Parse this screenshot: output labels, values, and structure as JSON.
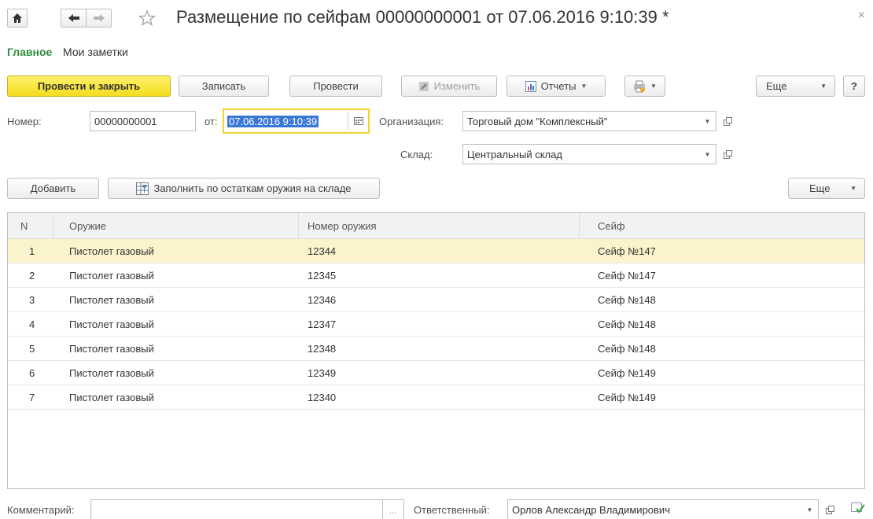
{
  "window": {
    "title": "Размещение по сейфам 00000000001 от 07.06.2016 9:10:39 *",
    "close_glyph": "×"
  },
  "tabs": [
    {
      "label": "Главное"
    },
    {
      "label": "Мои заметки"
    }
  ],
  "toolbar": {
    "post_and_close": "Провести и закрыть",
    "save": "Записать",
    "post": "Провести",
    "edit": "Изменить",
    "reports": "Отчеты",
    "more": "Еще",
    "help": "?"
  },
  "form": {
    "number_label": "Номер:",
    "number_value": "00000000001",
    "date_label": "от:",
    "date_value": "07.06.2016  9:10:39",
    "organization_label": "Организация:",
    "organization_value": "Торговый дом \"Комплексный\"",
    "warehouse_label": "Склад:",
    "warehouse_value": "Центральный склад"
  },
  "table_toolbar": {
    "add": "Добавить",
    "fill": "Заполнить по остаткам оружия на складе",
    "more": "Еще"
  },
  "table": {
    "columns": [
      "N",
      "Оружие",
      "Номер оружия",
      "Сейф"
    ],
    "rows": [
      {
        "n": "1",
        "weapon": "Пистолет газовый",
        "number": "12344",
        "safe": "Сейф №147"
      },
      {
        "n": "2",
        "weapon": "Пистолет газовый",
        "number": "12345",
        "safe": "Сейф №147"
      },
      {
        "n": "3",
        "weapon": "Пистолет газовый",
        "number": "12346",
        "safe": "Сейф №148"
      },
      {
        "n": "4",
        "weapon": "Пистолет газовый",
        "number": "12347",
        "safe": "Сейф №148"
      },
      {
        "n": "5",
        "weapon": "Пистолет газовый",
        "number": "12348",
        "safe": "Сейф №148"
      },
      {
        "n": "6",
        "weapon": "Пистолет газовый",
        "number": "12349",
        "safe": "Сейф №149"
      },
      {
        "n": "7",
        "weapon": "Пистолет газовый",
        "number": "12340",
        "safe": "Сейф №149"
      }
    ],
    "selected_row": 0
  },
  "footer": {
    "comment_label": "Комментарий:",
    "comment_value": "",
    "comment_ellipsis": "...",
    "responsible_label": "Ответственный:",
    "responsible_value": "Орлов Александр Владимирович"
  },
  "icons": {
    "home": "home-icon",
    "back": "arrow-left-icon",
    "forward": "arrow-right-icon",
    "favorite": "star-icon",
    "close": "close-icon",
    "calendar": "calendar-icon",
    "open": "open-in-window-icon",
    "dropdown": "chevron-down-icon",
    "edit": "pencil-icon",
    "reports": "chart-icon",
    "print": "printer-icon",
    "fill": "table-fill-icon",
    "check": "checkmark-icon"
  },
  "colors": {
    "primary_button": "#f5dc20",
    "active_tab": "#2f8e3d",
    "selected_row": "#fbf3cb",
    "focus_border": "#f4d42a",
    "date_selection": "#3a78d8"
  }
}
